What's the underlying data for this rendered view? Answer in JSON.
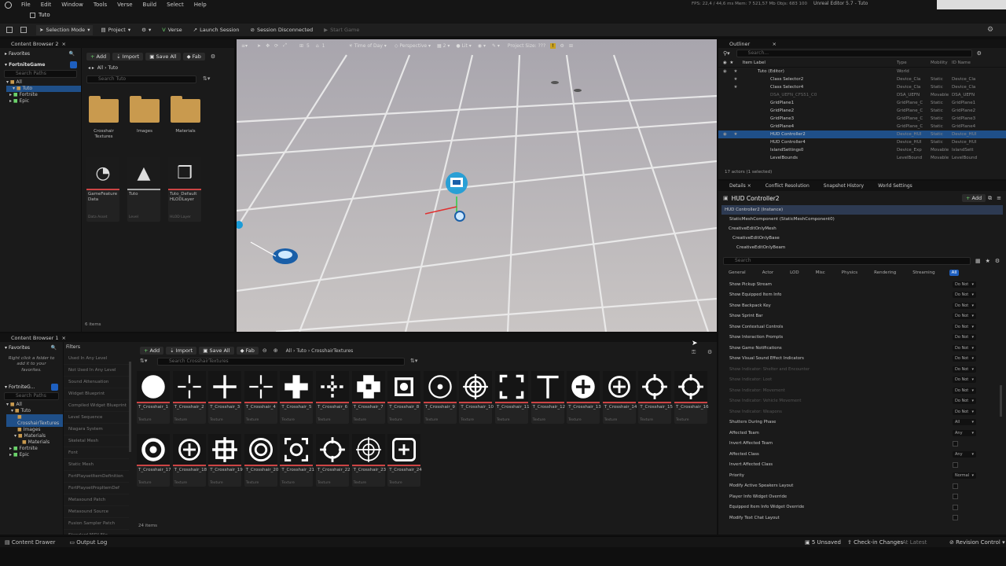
{
  "menu": [
    "File",
    "Edit",
    "Window",
    "Tools",
    "Verse",
    "Build",
    "Select",
    "Help"
  ],
  "level_tab": "Tuto",
  "title_right": {
    "stats": "FPS: 22,4 / 44,6 ms  Mem: 7 521,57 Mb  Objs: 683 100",
    "editor": "Unreal Editor 5.7 - Tuto"
  },
  "toolbar": {
    "selection_mode": "Selection Mode",
    "project": "Project",
    "verse": "Verse",
    "launch_session": "Launch Session",
    "session_disconnected": "Session Disconnected",
    "start_game": "Start Game"
  },
  "cb1": {
    "tab": "Content Browser 2",
    "favorites": "Favorites",
    "project": "FortniteGame",
    "search_placeholder": "Search Paths",
    "tree": [
      "All",
      "Tuto",
      "Fortnite",
      "Epic"
    ],
    "add": "Add",
    "import": "Import",
    "save_all": "Save All",
    "fab": "Fab",
    "path": [
      "All",
      "Tuto"
    ],
    "search_placeholder2": "Search Tuto",
    "folders": [
      {
        "name": "Crosshair Textures"
      },
      {
        "name": "Images"
      },
      {
        "name": "Materials"
      }
    ],
    "assets": [
      {
        "name": "GameFeature Data",
        "type": "Data Asset"
      },
      {
        "name": "Tuto",
        "type": "Level"
      },
      {
        "name": "Tuto_Default HLODLayer",
        "type": "HLOD Layer"
      }
    ],
    "count": "6 items"
  },
  "viewport": {
    "perspective": "Perspective",
    "lit": "Lit",
    "time_of_day": "Time of Day",
    "project_size": "Project Size: ???",
    "snap": "5",
    "cam": "1",
    "grid": "2"
  },
  "cb2": {
    "tab": "Content Browser 1",
    "favorites": "Favorites",
    "fav_hint": "Right click a folder to add it to your favorites.",
    "project": "FortniteG...",
    "search_placeholder": "Search Paths",
    "tree": [
      "All",
      "Tuto",
      "CrosshairTextures",
      "Images",
      "Materials",
      "Fortnite",
      "Epic"
    ],
    "filters_label": "Filters",
    "filters": [
      "Used In Any Level",
      "Not Used In Any Level",
      "Sound Attenuation",
      "Widget Blueprint",
      "Compiled Widget Blueprint",
      "Level Sequence",
      "Niagara System",
      "Skeletal Mesh",
      "Font",
      "Static Mesh",
      "FortPlaysetItemDefinition",
      "FortPlaysetPropItemDef",
      "Metasound Patch",
      "Metasound Source",
      "Fusion Sampler Patch",
      "Standard MIDI File"
    ],
    "add": "Add",
    "import": "Import",
    "save_all": "Save All",
    "fab": "Fab",
    "path": [
      "All",
      "Tuto",
      "CrosshairTextures"
    ],
    "search_placeholder2": "Search CrosshairTextures",
    "items": [
      {
        "name": "T_Crosshair_1",
        "type": "Texture",
        "icon": "filled-circle"
      },
      {
        "name": "T_Crosshair_2",
        "type": "Texture",
        "icon": "thin-cross"
      },
      {
        "name": "T_Crosshair_3",
        "type": "Texture",
        "icon": "cross"
      },
      {
        "name": "T_Crosshair_4",
        "type": "Texture",
        "icon": "gap-cross"
      },
      {
        "name": "T_Crosshair_5",
        "type": "Texture",
        "icon": "thick-plus"
      },
      {
        "name": "T_Crosshair_6",
        "type": "Texture",
        "icon": "dotted-cross"
      },
      {
        "name": "T_Crosshair_7",
        "type": "Texture",
        "icon": "diamond-cross"
      },
      {
        "name": "T_Crosshair_8",
        "type": "Texture",
        "icon": "square-bracket"
      },
      {
        "name": "T_Crosshair_9",
        "type": "Texture",
        "icon": "ring-dot"
      },
      {
        "name": "T_Crosshair_10",
        "type": "Texture",
        "icon": "ring-cross"
      },
      {
        "name": "T_Crosshair_11",
        "type": "Texture",
        "icon": "corner-square"
      },
      {
        "name": "T_Crosshair_12",
        "type": "Texture",
        "icon": "t-cross"
      },
      {
        "name": "T_Crosshair_13",
        "type": "Texture",
        "icon": "circle-plus"
      },
      {
        "name": "T_Crosshair_14",
        "type": "Texture",
        "icon": "ring-plus"
      },
      {
        "name": "T_Crosshair_15",
        "type": "Texture",
        "icon": "ring-ticks"
      },
      {
        "name": "T_Crosshair_16",
        "type": "Texture",
        "icon": "ring-ticks"
      },
      {
        "name": "T_Crosshair_17",
        "type": "Texture",
        "icon": "thick-ring"
      },
      {
        "name": "T_Crosshair_18",
        "type": "Texture",
        "icon": "ring-plus"
      },
      {
        "name": "T_Crosshair_19",
        "type": "Texture",
        "icon": "bracket-plus"
      },
      {
        "name": "T_Crosshair_20",
        "type": "Texture",
        "icon": "target"
      },
      {
        "name": "T_Crosshair_21",
        "type": "Texture",
        "icon": "corner-ring"
      },
      {
        "name": "T_Crosshair_22",
        "type": "Texture",
        "icon": "ring-ticks"
      },
      {
        "name": "T_Crosshair_23",
        "type": "Texture",
        "icon": "scope"
      },
      {
        "name": "T_Crosshair_24",
        "type": "Texture",
        "icon": "rounded-square-plus"
      }
    ],
    "count": "24 items"
  },
  "outliner": {
    "tab": "Outliner",
    "search_placeholder": "Search...",
    "cols": [
      "Item Label",
      "Type",
      "Mobility",
      "ID Name"
    ],
    "rows": [
      {
        "label": "Tuto (Editor)",
        "type": "World",
        "mob": "",
        "id": ""
      },
      {
        "label": "Class Selector2",
        "type": "Device_Cla",
        "mob": "Static",
        "id": "Device_Cla"
      },
      {
        "label": "Class Selector4",
        "type": "Device_Cla",
        "mob": "Static",
        "id": "Device_Cla"
      },
      {
        "label": "DSA_UEFN_CFS51_C0",
        "type": "DSA_UEFN",
        "mob": "Movable",
        "id": "DSA_UEFN"
      },
      {
        "label": "GridPlane1",
        "type": "GridPlane_C",
        "mob": "Static",
        "id": "GridPlane1"
      },
      {
        "label": "GridPlane2",
        "type": "GridPlane_C",
        "mob": "Static",
        "id": "GridPlane2"
      },
      {
        "label": "GridPlane3",
        "type": "GridPlane_C",
        "mob": "Static",
        "id": "GridPlane3"
      },
      {
        "label": "GridPlane4",
        "type": "GridPlane_C",
        "mob": "Static",
        "id": "GridPlane4"
      },
      {
        "label": "HUD Controller2",
        "type": "Device_HUI",
        "mob": "Static",
        "id": "Device_HUI"
      },
      {
        "label": "HUD Controller4",
        "type": "Device_HUI",
        "mob": "Static",
        "id": "Device_HUI"
      },
      {
        "label": "IslandSettings0",
        "type": "Device_Exp",
        "mob": "Movable",
        "id": "IslandSett"
      },
      {
        "label": "LevelBounds",
        "type": "LevelBound",
        "mob": "Movable",
        "id": "LevelBound"
      }
    ],
    "actors": "17 actors (1 selected)"
  },
  "details": {
    "tabs": [
      "Details",
      "Conflict Resolution",
      "Snapshot History",
      "World Settings"
    ],
    "title": "HUD Controller2",
    "add": "Add",
    "components": [
      "HUD Controller2 (Instance)",
      "StaticMeshComponent (StaticMeshComponent0)",
      "CreativeEditOnlyMesh",
      "CreativeEditOnlyBase",
      "CreativeEditOnlyBeam"
    ],
    "search_placeholder": "Search",
    "filters": [
      "General",
      "Actor",
      "LOD",
      "Misc",
      "Physics",
      "Rendering",
      "Streaming",
      "All"
    ],
    "props": [
      {
        "label": "Show Pickup Stream",
        "value": "Do Not",
        "dim": false
      },
      {
        "label": "Show Equipped Item Info",
        "value": "Do Not",
        "dim": false
      },
      {
        "label": "Show Backpack Key",
        "value": "Do Not",
        "dim": false
      },
      {
        "label": "Show Sprint Bar",
        "value": "Do Not",
        "dim": false
      },
      {
        "label": "Show Contextual Controls",
        "value": "Do Not",
        "dim": false
      },
      {
        "label": "Show Interaction Prompts",
        "value": "Do Not",
        "dim": false
      },
      {
        "label": "Show Game Notifications",
        "value": "Do Not",
        "dim": false
      },
      {
        "label": "Show Visual Sound Effect Indicators",
        "value": "Do Not",
        "dim": false
      },
      {
        "label": "Show Indicator: Shelter and Encounter",
        "value": "Do Not",
        "dim": true
      },
      {
        "label": "Show Indicator: Loot",
        "value": "Do Not",
        "dim": true
      },
      {
        "label": "Show Indicator: Movement",
        "value": "Do Not",
        "dim": true
      },
      {
        "label": "Show Indicator: Vehicle Movement",
        "value": "Do Not",
        "dim": true
      },
      {
        "label": "Show Indicator: Weapons",
        "value": "Do Not",
        "dim": true
      },
      {
        "label": "Shutters During Phase",
        "value": "All",
        "dim": false
      },
      {
        "label": "Affected Team",
        "value": "Any",
        "dim": false
      },
      {
        "label": "Invert Affected Team",
        "value": "",
        "dim": false
      },
      {
        "label": "Affected Class",
        "value": "Any",
        "dim": false
      },
      {
        "label": "Invert Affected Class",
        "value": "",
        "dim": false
      },
      {
        "label": "Priority",
        "value": "Normal",
        "dim": false
      },
      {
        "label": "Modify Active Speakers Layout",
        "value": "",
        "dim": false
      },
      {
        "label": "Player Info Widget Override",
        "value": "",
        "dim": false
      },
      {
        "label": "Equipped Item Info Widget Override",
        "value": "",
        "dim": false
      },
      {
        "label": "Modify Text Chat Layout",
        "value": "",
        "dim": false
      }
    ]
  },
  "status": {
    "content_drawer": "Content Drawer",
    "output_log": "Output Log",
    "unsaved": "5 Unsaved",
    "check_in": "Check-in Changes",
    "at_latest": "At Latest",
    "revision_control": "Revision Control"
  }
}
